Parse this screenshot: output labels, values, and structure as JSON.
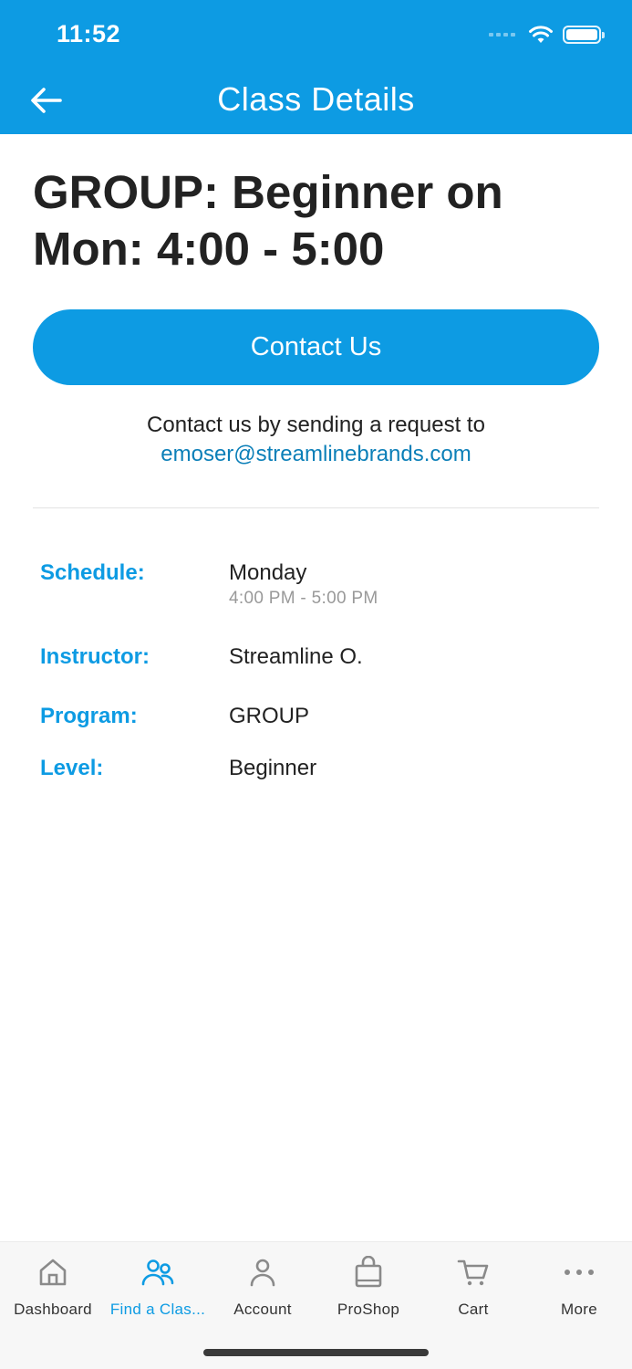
{
  "status_bar": {
    "time": "11:52"
  },
  "header": {
    "title": "Class Details"
  },
  "class": {
    "title_line1": "GROUP: Beginner on",
    "title_line2": "Mon: 4:00 - 5:00"
  },
  "contact": {
    "button_label": "Contact Us",
    "text": "Contact us by sending a request to",
    "email": "emoser@streamlinebrands.com"
  },
  "details": {
    "schedule": {
      "label": "Schedule:",
      "value": "Monday",
      "sub": "4:00 PM - 5:00 PM"
    },
    "instructor": {
      "label": "Instructor:",
      "value": "Streamline O."
    },
    "program": {
      "label": "Program:",
      "value": "GROUP"
    },
    "level": {
      "label": "Level:",
      "value": "Beginner"
    }
  },
  "tabbar": {
    "tabs": [
      {
        "label": "Dashboard",
        "icon": "home-icon"
      },
      {
        "label": "Find a Clas...",
        "icon": "people-icon",
        "active": true
      },
      {
        "label": "Account",
        "icon": "person-icon"
      },
      {
        "label": "ProShop",
        "icon": "shopping-bag-icon"
      },
      {
        "label": "Cart",
        "icon": "cart-icon"
      },
      {
        "label": "More",
        "icon": "more-icon"
      }
    ]
  },
  "colors": {
    "accent": "#0d9be3",
    "link": "#0b7fb8",
    "text": "#222222",
    "muted": "#999999"
  }
}
